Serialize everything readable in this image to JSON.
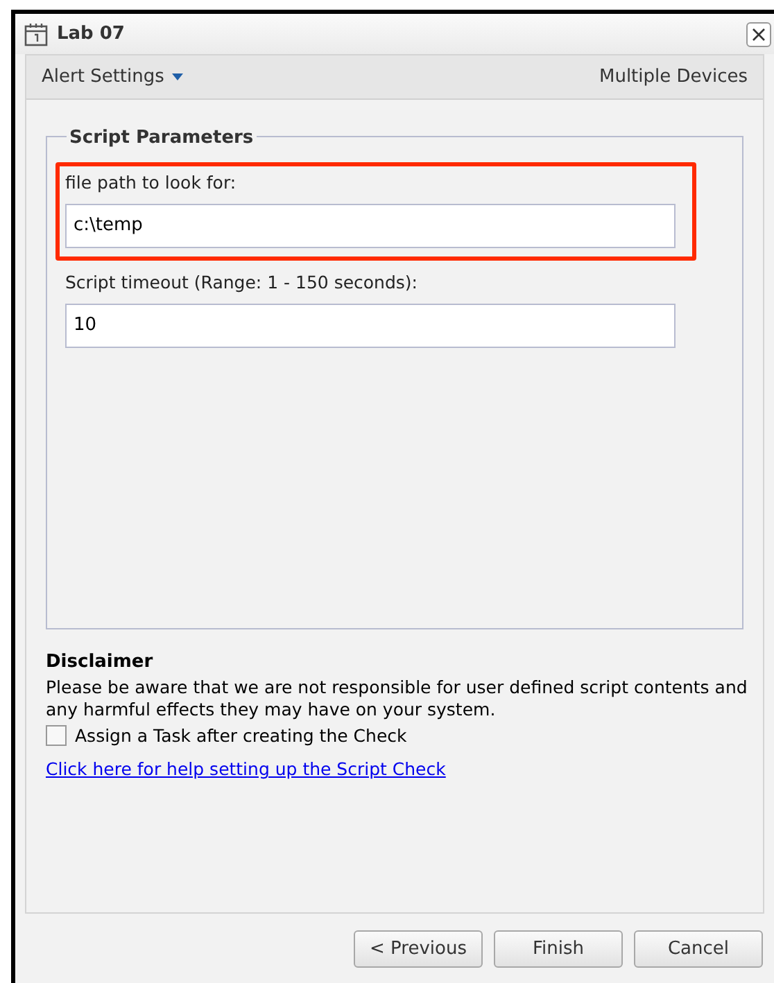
{
  "window": {
    "title": "Lab 07"
  },
  "header": {
    "menu": "Alert Settings",
    "devices": "Multiple Devices"
  },
  "fieldset": {
    "legend": "Script Parameters",
    "fields": [
      {
        "label": "file path to look for:",
        "value": "c:\\temp",
        "highlighted": true
      },
      {
        "label": "Script timeout (Range: 1 - 150 seconds):",
        "value": "10",
        "highlighted": false
      }
    ]
  },
  "disclaimer": {
    "title": "Disclaimer",
    "text": "Please be aware that we are not responsible for user defined script contents and any harmful effects they may have on your system."
  },
  "assign_task": {
    "label": "Assign a Task after creating the Check",
    "checked": false
  },
  "help_link": "Click here for help setting up the Script Check",
  "buttons": [
    "< Previous",
    "Finish",
    "Cancel"
  ]
}
